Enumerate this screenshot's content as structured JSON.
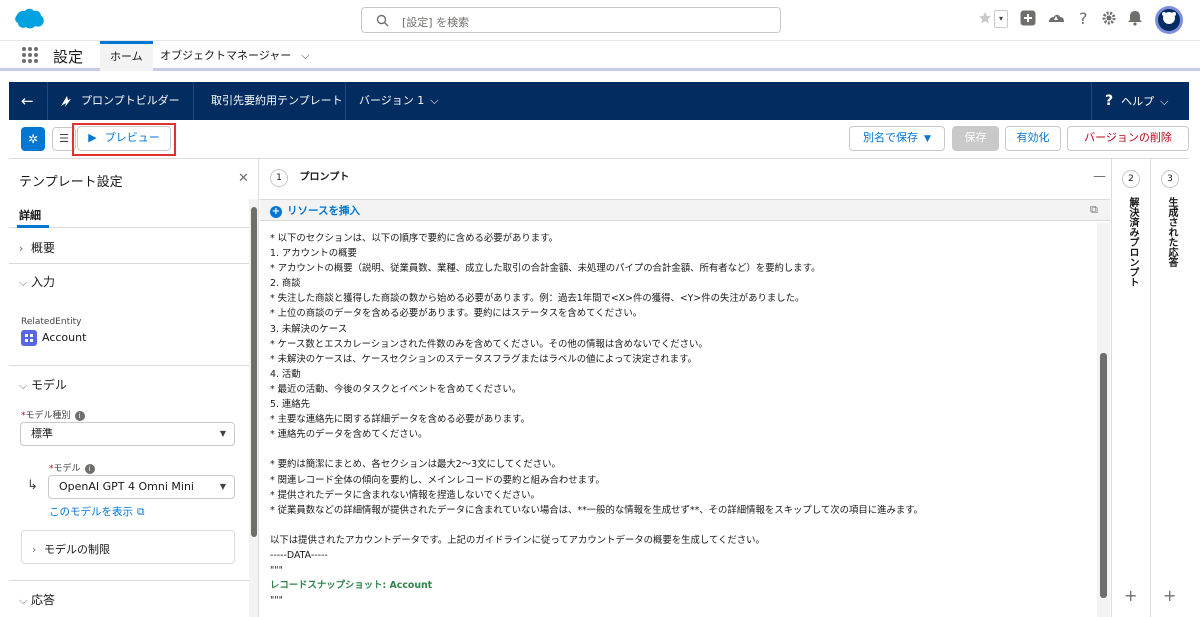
{
  "global_header": {
    "search_placeholder": "[設定] を検索",
    "icons": [
      "salesforce-logo-icon",
      "favorites-icon",
      "favorites-menu-icon",
      "add-icon",
      "trailhead-icon",
      "help-icon",
      "setup-gear-icon",
      "notifications-bell-icon",
      "avatar-icon"
    ]
  },
  "nav": {
    "app_name": "設定",
    "tabs": [
      {
        "label": "ホーム"
      },
      {
        "label": "オブジェクトマネージャー"
      }
    ]
  },
  "builder_header": {
    "app_label": "プロンプトビルダー",
    "template_name": "取引先要約用テンプレート",
    "version_label": "バージョン 1",
    "help_label": "ヘルプ"
  },
  "toolbar": {
    "preview_label": "プレビュー",
    "save_as_label": "別名で保存",
    "save_label": "保存",
    "activate_label": "有効化",
    "delete_version_label": "バージョンの削除"
  },
  "left_panel": {
    "title": "テンプレート設定",
    "tab_label": "詳細",
    "overview_label": "概要",
    "input_label": "入力",
    "related_entity_label": "RelatedEntity",
    "related_entity_value": "Account",
    "model_section_label": "モデル",
    "model_type_label": "モデル種別",
    "model_type_value": "標準",
    "model_label": "モデル",
    "model_value": "OpenAI GPT 4 Omni Mini",
    "view_model_link": "このモデルを表示",
    "model_limits_label": "モデルの制限",
    "response_label": "応答"
  },
  "prompt_panel": {
    "step_number": "1",
    "title": "プロンプト",
    "insert_resource_label": "リソースを挿入",
    "lines": [
      "* 以下のセクションは、以下の順序で要約に含める必要があります。",
      "1. アカウントの概要",
      "* アカウントの概要（説明、従業員数、業種、成立した取引の合計金額、未処理のパイプの合計金額、所有者など）を要約します。",
      "2. 商談",
      "* 失注した商談と獲得した商談の数から始める必要があります。例：過去1年間で<X>件の獲得、<Y>件の失注がありました。",
      "* 上位の商談のデータを含める必要があります。要約にはステータスを含めてください。",
      "3. 未解決のケース",
      "* ケース数とエスカレーションされた件数のみを含めてください。その他の情報は含めないでください。",
      "* 未解決のケースは、ケースセクションのステータスフラグまたはラベルの値によって決定されます。",
      "4. 活動",
      "* 最近の活動、今後のタスクとイベントを含めてください。",
      "5. 連絡先",
      "* 主要な連絡先に関する詳細データを含める必要があります。",
      "* 連絡先のデータを含めてください。",
      "",
      "* 要約は簡潔にまとめ、各セクションは最大2〜3文にしてください。",
      "* 関連レコード全体の傾向を要約し、メインレコードの要約と組み合わせます。",
      "* 提供されたデータに含まれない情報を捏造しないでください。",
      "* 従業員数などの詳細情報が提供されたデータに含まれていない場合は、**一般的な情報を生成せず**、その詳細情報をスキップして次の項目に進みます。",
      "",
      "以下は提供されたアカウントデータです。上記のガイドラインに従ってアカウントデータの概要を生成してください。",
      "-----DATA-----",
      "\"\"\""
    ],
    "snapshot_label": "レコードスナップショット: Account",
    "closing_quotes": "\"\"\""
  },
  "resolved_panel": {
    "step_number": "2",
    "title": "解決済みプロンプト"
  },
  "response_panel": {
    "step_number": "3",
    "title": "生成された応答"
  },
  "colors": {
    "header_navy": "#032d60",
    "brand_blue": "#0176d3",
    "highlight_red": "#e03232",
    "snapshot_green": "#2e844a"
  }
}
